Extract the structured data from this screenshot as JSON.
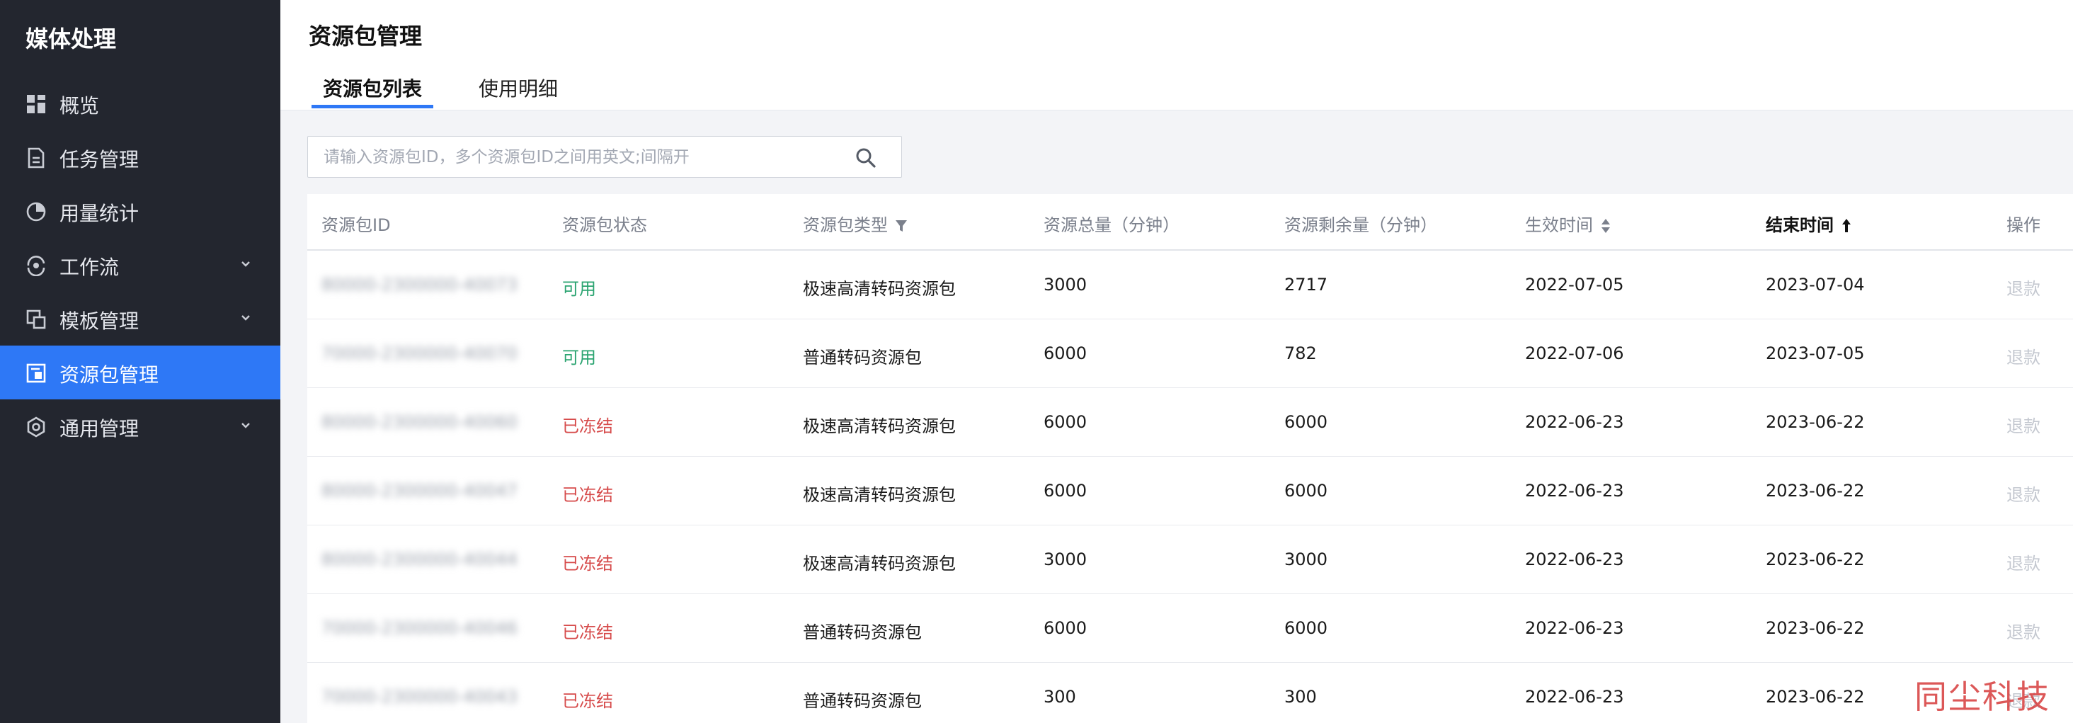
{
  "sidebar": {
    "title": "媒体处理",
    "items": [
      {
        "label": "概览",
        "icon": "grid-icon"
      },
      {
        "label": "任务管理",
        "icon": "document-icon"
      },
      {
        "label": "用量统计",
        "icon": "pie-chart-icon"
      },
      {
        "label": "工作流",
        "icon": "workflow-icon",
        "expandable": true
      },
      {
        "label": "模板管理",
        "icon": "template-icon",
        "expandable": true
      },
      {
        "label": "资源包管理",
        "icon": "package-icon",
        "active": true
      },
      {
        "label": "通用管理",
        "icon": "settings-icon",
        "expandable": true
      }
    ]
  },
  "header": {
    "title": "资源包管理",
    "tabs": [
      {
        "label": "资源包列表",
        "active": true
      },
      {
        "label": "使用明细",
        "active": false
      }
    ]
  },
  "search": {
    "placeholder": "请输入资源包ID，多个资源包ID之间用英文;间隔开",
    "value": ""
  },
  "table": {
    "columns": [
      {
        "label": "资源包ID"
      },
      {
        "label": "资源包状态"
      },
      {
        "label": "资源包类型",
        "icon": "filter-icon"
      },
      {
        "label": "资源总量（分钟）"
      },
      {
        "label": "资源剩余量（分钟）"
      },
      {
        "label": "生效时间",
        "icon": "sort-icon"
      },
      {
        "label": "结束时间",
        "icon": "sort-asc-icon",
        "bold": true
      },
      {
        "label": "操作"
      }
    ],
    "rows": [
      {
        "id": "80000-2300000-40073",
        "status": "可用",
        "status_type": "ok",
        "type": "极速高清转码资源包",
        "total": "3000",
        "remaining": "2717",
        "start": "2022-07-05",
        "end": "2023-07-04",
        "action": "退款"
      },
      {
        "id": "70000-2300000-40070",
        "status": "可用",
        "status_type": "ok",
        "type": "普通转码资源包",
        "total": "6000",
        "remaining": "782",
        "start": "2022-07-06",
        "end": "2023-07-05",
        "action": "退款"
      },
      {
        "id": "80000-2300000-40060",
        "status": "已冻结",
        "status_type": "frozen",
        "type": "极速高清转码资源包",
        "total": "6000",
        "remaining": "6000",
        "start": "2022-06-23",
        "end": "2023-06-22",
        "action": "退款"
      },
      {
        "id": "80000-2300000-40047",
        "status": "已冻结",
        "status_type": "frozen",
        "type": "极速高清转码资源包",
        "total": "6000",
        "remaining": "6000",
        "start": "2022-06-23",
        "end": "2023-06-22",
        "action": "退款"
      },
      {
        "id": "80000-2300000-40044",
        "status": "已冻结",
        "status_type": "frozen",
        "type": "极速高清转码资源包",
        "total": "3000",
        "remaining": "3000",
        "start": "2022-06-23",
        "end": "2023-06-22",
        "action": "退款"
      },
      {
        "id": "70000-2300000-40046",
        "status": "已冻结",
        "status_type": "frozen",
        "type": "普通转码资源包",
        "total": "6000",
        "remaining": "6000",
        "start": "2022-06-23",
        "end": "2023-06-22",
        "action": "退款"
      },
      {
        "id": "70000-2300000-40043",
        "status": "已冻结",
        "status_type": "frozen",
        "type": "普通转码资源包",
        "total": "300",
        "remaining": "300",
        "start": "2022-06-23",
        "end": "2023-06-22",
        "action": "退款"
      }
    ]
  },
  "colors": {
    "sidebar_bg": "#23262f",
    "accent": "#2e78f6",
    "status_ok": "#2ba471",
    "status_frozen": "#d64a4a"
  },
  "watermark": "同尘科技"
}
